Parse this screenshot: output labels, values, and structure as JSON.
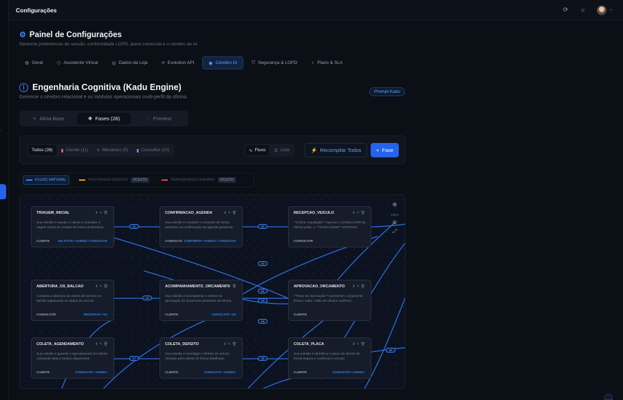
{
  "app": {
    "title": "Configurações"
  },
  "page": {
    "title": "Painel de Configurações",
    "subtitle": "Gerencie preferências de sessão, conformidade LGPD, plano comercial e o cérebro da IA."
  },
  "tabs": [
    {
      "label": "Geral",
      "icon": "gear-icon"
    },
    {
      "label": "Assistente Virtual",
      "icon": "user-icon"
    },
    {
      "label": "Dados da Loja",
      "icon": "location-icon"
    },
    {
      "label": "Evolution API",
      "icon": "link-icon"
    },
    {
      "label": "Cérebro IA",
      "icon": "brain-icon",
      "active": true
    },
    {
      "label": "Segurança & LGPD",
      "icon": "shield-icon"
    },
    {
      "label": "Plano & SLA",
      "icon": "badge-icon"
    }
  ],
  "section": {
    "title": "Engenharia Cognitiva (Kadu Engine)",
    "subtitle": "Gerencie o cérebro relacional e os módulos operacionais multi-perfil da oficina.",
    "prompt_button": "Prompt Kadu"
  },
  "segments": [
    {
      "label": "Alma Base"
    },
    {
      "label": "Fases (28)",
      "active": true
    },
    {
      "label": "Preview"
    }
  ],
  "filters": [
    {
      "label": "Todos (28)",
      "active": true
    },
    {
      "label": "Cliente (11)"
    },
    {
      "label": "Mecânico (5)"
    },
    {
      "label": "Consultor (10)"
    }
  ],
  "views": [
    {
      "label": "Fluxo",
      "active": true
    },
    {
      "label": "Lista"
    }
  ],
  "actions": {
    "recompile": "Recompilar Todos",
    "add_phase": "Fase"
  },
  "legend": [
    {
      "label": "FLUXO NATURAL",
      "active": true
    },
    {
      "label": "PIVOTAGEM (DESVIO)",
      "badge": "OCULTO"
    },
    {
      "label": "TRANSBORDO HUMANO",
      "badge": "OCULTO"
    }
  ],
  "zoom": {
    "level": "100%"
  },
  "nodes": [
    {
      "title": "TRIAGEM_INICIAL",
      "desc": "Sua missão é saudar o cliente e entender a origem inicial do contato de forma acolhedora.",
      "role": "CLIENTE",
      "tag": "SOLICITAR • AGENDA • CONSULTAR"
    },
    {
      "title": "CONFIRMACAO_AGENDA",
      "desc": "Sua missão é conduzir o consultor de forma assertiva na confirmação da agenda pendente.",
      "role": "CONSULTOR",
      "tag": "CONFIRMAR • AGENDA • CONSULTAR"
    },
    {
      "title": "RECEPCAO_VEICULO",
      "desc": "**Crítica: Saudação** Apenas o CONSULTOR da oficina pode: 1. **CHECAGEM** ENTRADA",
      "role": "CONSULTOR",
      "tag": ""
    },
    {
      "title": "ABERTURA_OS_BALCAO",
      "desc": "Conduza a abertura da ordem de serviço no balcão registrando os dados do veículo.",
      "role": "CONSULTOR",
      "tag": "REGISTRAR • OS"
    },
    {
      "title": "ACOMPANHAMENTO_ORCAMENTO",
      "desc": "Sua missão é acompanhar o cliente na aprovação do orçamento pendente da oficina.",
      "role": "CLIENTE",
      "tag": "CONSULTAR • OS"
    },
    {
      "title": "APROVACAO_ORCAMENTO",
      "desc": "**Fluxo de Aprovação** Apresente o orçamento [Peça • Valor • Mão de obra] e confirme.",
      "role": "CLIENTE",
      "tag": ""
    },
    {
      "title": "COLETA_AGENDAMENTO",
      "desc": "Sua missão é garantir o agendamento do cliente coletando data e horário disponíveis.",
      "role": "CLIENTE",
      "tag": "CONSULTAR • AGENDA"
    },
    {
      "title": "COLETA_DEFEITO",
      "desc": "Sua missão é investigar o defeito do veículo relatado pelo cliente de forma detalhada.",
      "role": "CLIENTE",
      "tag": "CONSULTAR • AGENDA"
    },
    {
      "title": "COLETA_PLACA",
      "desc": "Sua missão é identificar a placa do cliente de forma segura e confirmar o veículo.",
      "role": "CLIENTE",
      "tag": "CONSULTAR • AGENDA"
    }
  ]
}
